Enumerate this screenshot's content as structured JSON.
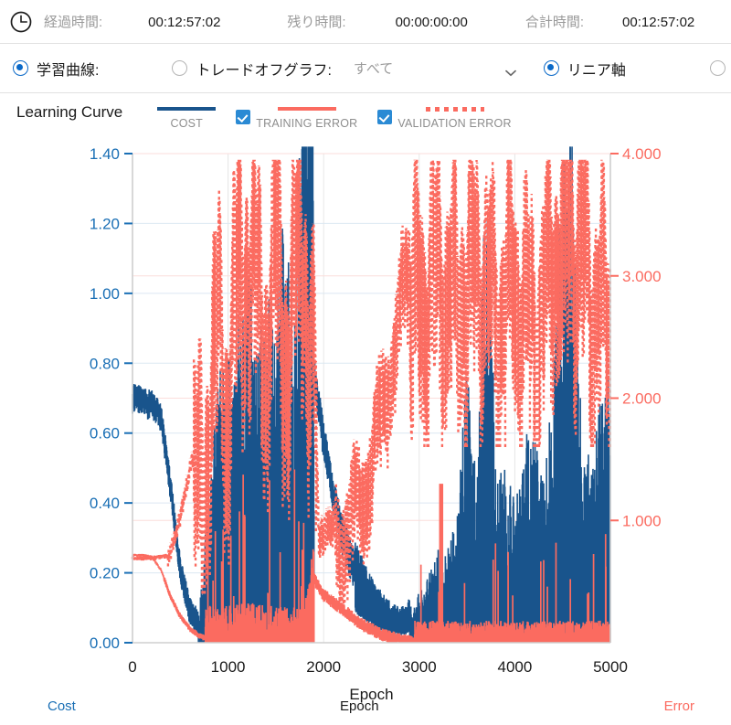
{
  "status_bar": {
    "clock_icon": "clock-icon",
    "elapsed": {
      "label": "経過時間:",
      "value": "00:12:57:02"
    },
    "remaining": {
      "label": "残り時間:",
      "value": "00:00:00:00"
    },
    "total": {
      "label": "合計時間:",
      "value": "00:12:57:02"
    }
  },
  "options_bar": {
    "learning_curve": {
      "label": "学習曲線:",
      "selected": true
    },
    "tradeoff_graph": {
      "label": "トレードオフグラフ:",
      "selected": false
    },
    "tradeoff_dropdown": {
      "value": "すべて",
      "icon": "chevron-down-icon"
    },
    "linear_axis": {
      "label": "リニア軸",
      "selected": true
    },
    "log_axis": {
      "label": "",
      "selected": false
    }
  },
  "chart": {
    "title": "Learning Curve",
    "legend": [
      {
        "name": "cost",
        "label": "COST",
        "color": "#19548c",
        "style": "solid",
        "has_checkbox": false,
        "checked": false
      },
      {
        "name": "training-error",
        "label": "TRAINING ERROR",
        "color": "#fb6b60",
        "style": "solid",
        "has_checkbox": true,
        "checked": true
      },
      {
        "name": "validation-error",
        "label": "VALIDATION ERROR",
        "color": "#fb6b60",
        "style": "dotted",
        "has_checkbox": true,
        "checked": true
      }
    ],
    "footer": {
      "left_axis_name": "Cost",
      "x_axis_name": "Epoch",
      "right_axis_name": "Error"
    }
  },
  "chart_data": {
    "type": "line",
    "title": "Learning Curve",
    "xlabel": "Epoch",
    "ylabel": "Cost",
    "y2label": "Error",
    "xlim": [
      0,
      5000
    ],
    "xticks": [
      "0",
      "1000",
      "2000",
      "3000",
      "4000",
      "5000"
    ],
    "ylim": [
      0.0,
      1.4
    ],
    "yticks": [
      "0.00",
      "0.20",
      "0.40",
      "0.60",
      "0.80",
      "1.00",
      "1.20",
      "1.40"
    ],
    "y2lim": [
      0.0,
      4.0
    ],
    "y2ticks": [
      "1.000",
      "2.000",
      "3.000",
      "4.000"
    ],
    "grid": true,
    "legend_position": "top",
    "left_axis_color": "#1a6fb5",
    "right_axis_color": "#fb6b60",
    "series": [
      {
        "name": "COST",
        "axis": "left",
        "color": "#19548c",
        "style": "solid",
        "description": "Noisy cost signal: starts ~0.72, decays to ~0.02 near epoch 700, then dense spiky region 700-1900 with spikes up to ~1.42 at epoch 1880, drops again to ~0.70 at 1900 decaying to ~0.05 by 2800, then a growing spiky band 2900-5000 with peaks up to ~1.28.",
        "x": [
          0,
          100,
          200,
          300,
          400,
          500,
          600,
          700,
          800,
          900,
          1000,
          1100,
          1200,
          1300,
          1400,
          1500,
          1600,
          1700,
          1800,
          1880,
          1900,
          2000,
          2100,
          2200,
          2300,
          2400,
          2500,
          2600,
          2700,
          2800,
          2900,
          3000,
          3100,
          3200,
          3300,
          3400,
          3500,
          3600,
          3700,
          3800,
          3900,
          4000,
          4100,
          4200,
          4300,
          4400,
          4500,
          4600,
          4700,
          4800,
          4900,
          5000
        ],
        "y": [
          0.72,
          0.71,
          0.7,
          0.66,
          0.45,
          0.22,
          0.1,
          0.06,
          0.3,
          0.52,
          0.55,
          0.62,
          0.78,
          0.56,
          0.7,
          0.62,
          0.88,
          0.74,
          1.31,
          1.42,
          0.8,
          0.62,
          0.45,
          0.35,
          0.26,
          0.2,
          0.14,
          0.1,
          0.07,
          0.05,
          0.08,
          0.12,
          0.16,
          0.22,
          0.24,
          0.3,
          0.7,
          0.33,
          1.22,
          0.4,
          0.42,
          0.35,
          0.48,
          0.52,
          0.38,
          0.55,
          1.24,
          1.28,
          0.46,
          0.4,
          0.58,
          0.63
        ]
      },
      {
        "name": "TRAINING ERROR",
        "axis": "right",
        "color": "#fb6b60",
        "style": "solid",
        "description": "Training error starts ~0.72 (right axis), dips to ~0.02 by epoch 800, stays near zero with occasional spikes to ~1.5 through 1900, rises briefly then decays back to near zero by 3000, remaining near zero with sparse spikes (largest ~1.3 at epoch 3230) through 5000.",
        "x": [
          0,
          100,
          200,
          300,
          400,
          500,
          600,
          700,
          800,
          900,
          1000,
          1200,
          1400,
          1600,
          1800,
          1900,
          2000,
          2200,
          2400,
          2600,
          2800,
          3000,
          3230,
          3400,
          3600,
          3800,
          4000,
          4200,
          4400,
          4600,
          4800,
          5000
        ],
        "y": [
          0.72,
          0.72,
          0.71,
          0.6,
          0.38,
          0.22,
          0.12,
          0.06,
          0.03,
          0.02,
          0.02,
          0.05,
          0.03,
          0.02,
          0.04,
          0.55,
          0.42,
          0.3,
          0.18,
          0.1,
          0.05,
          0.03,
          1.3,
          0.06,
          0.1,
          0.08,
          0.06,
          0.12,
          0.09,
          0.07,
          0.14,
          0.1
        ]
      },
      {
        "name": "VALIDATION ERROR",
        "axis": "right",
        "color": "#fb6b60",
        "style": "dotted",
        "description": "Validation error flat ~0.70 until epoch 380, then climbs steeply; oscillates in a broad band between ~1.8 and ~3.9 from epoch 700 to 1900; dips to ~0.9 at 1950 then climbs again from 2100 reaching a wide noisy band ~2.4-3.9 between 2900 and 5000.",
        "x": [
          0,
          200,
          380,
          500,
          600,
          700,
          800,
          900,
          1000,
          1100,
          1200,
          1300,
          1400,
          1500,
          1600,
          1700,
          1800,
          1900,
          1950,
          2050,
          2200,
          2400,
          2600,
          2800,
          2900,
          3000,
          3200,
          3400,
          3600,
          3800,
          4000,
          4200,
          4400,
          4600,
          4800,
          5000
        ],
        "y": [
          0.7,
          0.7,
          0.72,
          1.05,
          1.45,
          1.72,
          2.3,
          2.95,
          2.55,
          3.4,
          3.75,
          3.2,
          3.05,
          3.6,
          3.0,
          3.35,
          3.7,
          2.6,
          0.9,
          1.0,
          1.1,
          1.35,
          2.0,
          2.9,
          3.2,
          3.3,
          3.45,
          3.25,
          3.55,
          3.15,
          3.4,
          3.0,
          3.6,
          3.8,
          3.35,
          3.05
        ]
      }
    ]
  }
}
